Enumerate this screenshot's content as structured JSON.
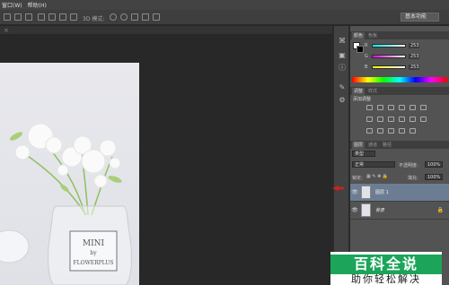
{
  "menubar": {
    "items": [
      "窗口(W)",
      "帮助(H)"
    ]
  },
  "options_bar": {
    "mode_3d_label": "3D 模式:"
  },
  "workspace": {
    "label": "基本功能"
  },
  "color_panel": {
    "tabs": [
      "颜色",
      "色板"
    ],
    "channels": [
      {
        "label": "R",
        "value": "253",
        "gradient": "linear-gradient(90deg,#00fdfd,#fdfdfd)"
      },
      {
        "label": "G",
        "value": "253",
        "gradient": "linear-gradient(90deg,#fd00fd,#fdfdfd)"
      },
      {
        "label": "B",
        "value": "253",
        "gradient": "linear-gradient(90deg,#fdfd00,#fdfdfd)"
      }
    ]
  },
  "adjust_panel": {
    "tabs": [
      "调整",
      "样式"
    ],
    "title": "添加调整"
  },
  "layers_panel": {
    "tabs": [
      "图层",
      "通道",
      "路径"
    ],
    "kind_label": "类型",
    "blend_mode": "正常",
    "opacity_label": "不透明度:",
    "opacity_value": "100%",
    "lock_label": "锁定:",
    "fill_label": "填充:",
    "fill_value": "100%",
    "layers": [
      {
        "name": "图层 1",
        "selected": true
      },
      {
        "name": "背景",
        "selected": false
      }
    ]
  },
  "watermark": {
    "line1": "百科全说",
    "line2": "助你轻松解决"
  },
  "photo": {
    "label_lines": [
      "MINI",
      "by",
      "FLOWERPLUS"
    ]
  }
}
